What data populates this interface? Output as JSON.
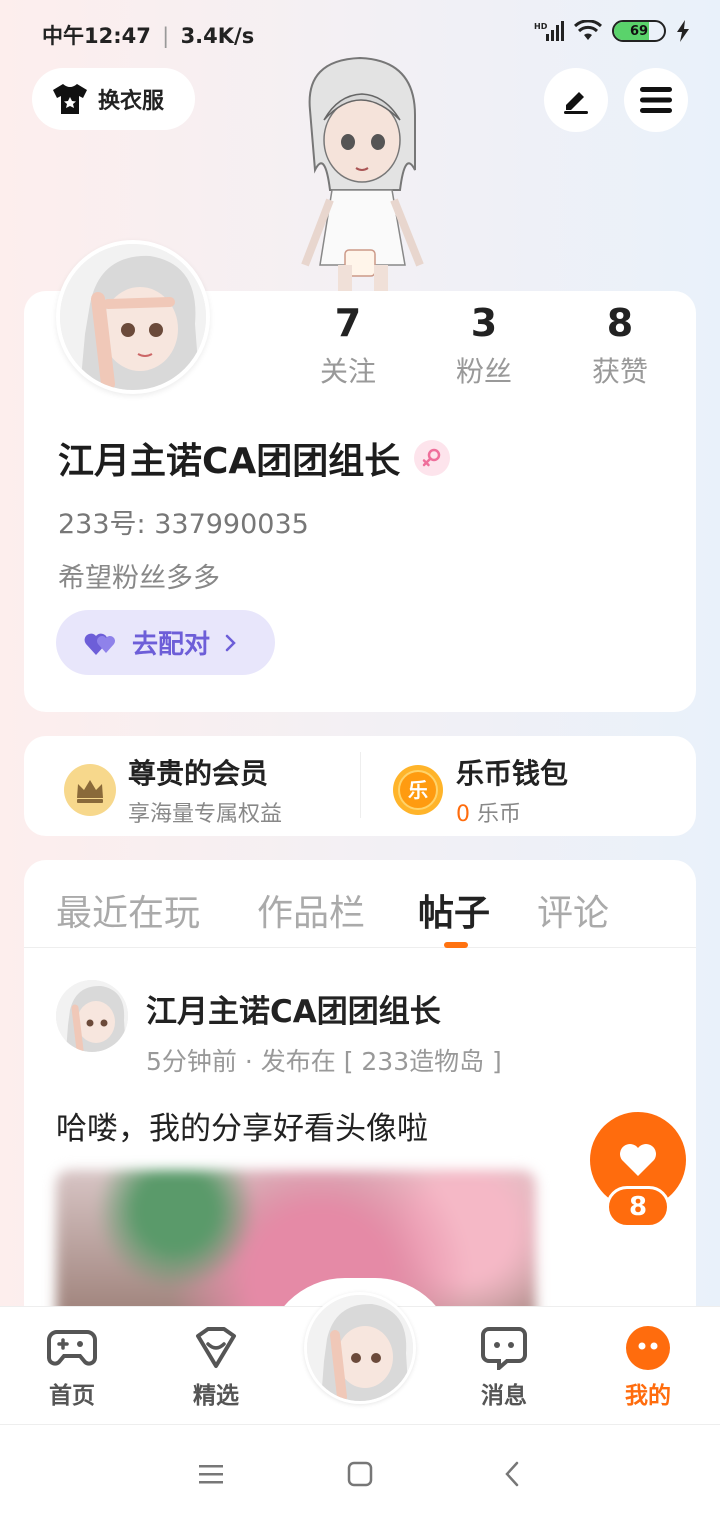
{
  "status_bar": {
    "time": "中午12:47",
    "speed": "3.4K/s",
    "battery": "69",
    "battery_level": 0.69
  },
  "header": {
    "outfit_label": "换衣服"
  },
  "profile": {
    "stats": [
      {
        "value": "7",
        "label": "关注"
      },
      {
        "value": "3",
        "label": "粉丝"
      },
      {
        "value": "8",
        "label": "获赞"
      }
    ],
    "name": "江月主诺CA团团组长",
    "id_text": "233号: 337990035",
    "bio": "希望粉丝多多",
    "pair_label": "去配对"
  },
  "member": {
    "vip_title": "尊贵的会员",
    "vip_sub": "享海量专属权益",
    "wallet_title": "乐币钱包",
    "wallet_amount": "0",
    "wallet_unit": "乐币"
  },
  "tabs": [
    "最近在玩",
    "作品栏",
    "帖子",
    "评论"
  ],
  "post": {
    "author": "江月主诺CA团团组长",
    "meta": "5分钟前 · 发布在 [ 233造物岛 ]",
    "text": "哈喽，我的分享好看头像啦"
  },
  "like_count": "8",
  "bottom_nav": [
    "首页",
    "精选",
    "消息",
    "我的"
  ],
  "colors": {
    "accent": "#ff6c0d",
    "pair_bg": "#e8e6fb",
    "pair_text": "#6d5ed8"
  }
}
